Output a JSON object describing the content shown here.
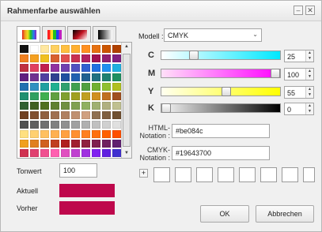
{
  "window": {
    "title": "Rahmenfarbe auswählen"
  },
  "model": {
    "label": "Modell :",
    "value": "CMYK"
  },
  "cmyk": [
    {
      "letter": "C",
      "value": "25",
      "level": 0.25
    },
    {
      "letter": "M",
      "value": "100",
      "level": 1.0
    },
    {
      "letter": "Y",
      "value": "55",
      "level": 0.55
    },
    {
      "letter": "K",
      "value": "0",
      "level": 0.0
    }
  ],
  "html_notation": {
    "label_1": "HTML-",
    "label_2": "Notation :",
    "value": "#be084c"
  },
  "cmyk_notation": {
    "label_1": "CMYK-",
    "label_2": "Notation :",
    "value": "#19643700"
  },
  "tonwert": {
    "label": "Tonwert",
    "value": "100"
  },
  "aktuell": {
    "label": "Aktuell",
    "color": "#be084c"
  },
  "vorher": {
    "label": "Vorher",
    "color": "#be084c"
  },
  "buttons": {
    "ok": "OK",
    "cancel": "Abbrechen"
  },
  "custom_colors_count": 8,
  "palette_colors": [
    "#111111",
    "#ffffff",
    "#ffe8a0",
    "#ffd060",
    "#ffc040",
    "#ffb030",
    "#ff9020",
    "#e67010",
    "#cc5500",
    "#b04000",
    "#f08020",
    "#f5a020",
    "#f0c020",
    "#d86030",
    "#e05050",
    "#c83050",
    "#b02060",
    "#a01050",
    "#902070",
    "#802080",
    "#c03040",
    "#e04060",
    "#c02050",
    "#9030a0",
    "#7040b0",
    "#5050c0",
    "#3060d0",
    "#2070e0",
    "#2090f0",
    "#20b0e0",
    "#602080",
    "#703090",
    "#5040a0",
    "#304090",
    "#2050a0",
    "#2060b0",
    "#206090",
    "#207080",
    "#208070",
    "#209060",
    "#2070b0",
    "#3090c0",
    "#20a0a0",
    "#20b090",
    "#30a070",
    "#40a050",
    "#50a040",
    "#70b030",
    "#90c030",
    "#b0c020",
    "#209070",
    "#30a060",
    "#40b050",
    "#60a040",
    "#80a030",
    "#a0a020",
    "#c0a020",
    "#d09020",
    "#c07020",
    "#a05020",
    "#306030",
    "#406020",
    "#507020",
    "#608030",
    "#709040",
    "#80a050",
    "#90b060",
    "#a0b070",
    "#b0b080",
    "#c0c090",
    "#704020",
    "#805030",
    "#906040",
    "#a07050",
    "#b08060",
    "#c09070",
    "#d0a080",
    "#907050",
    "#806040",
    "#705030",
    "#505050",
    "#606060",
    "#707070",
    "#808080",
    "#909090",
    "#a0a0a0",
    "#b0b0b0",
    "#c0c0c0",
    "#d0d0d0",
    "#e0e0e0",
    "#ffe080",
    "#ffd070",
    "#ffc060",
    "#ffb050",
    "#ffa040",
    "#ff9030",
    "#ff8020",
    "#ff7010",
    "#ff6000",
    "#ff5000",
    "#f0a020",
    "#e08020",
    "#d06020",
    "#c04020",
    "#b02020",
    "#a02030",
    "#902040",
    "#802050",
    "#702060",
    "#602070",
    "#d03050",
    "#e04070",
    "#f05090",
    "#ff60b0",
    "#e050c0",
    "#c040d0",
    "#a030e0",
    "#8020f0",
    "#6020e0",
    "#4030d0"
  ]
}
